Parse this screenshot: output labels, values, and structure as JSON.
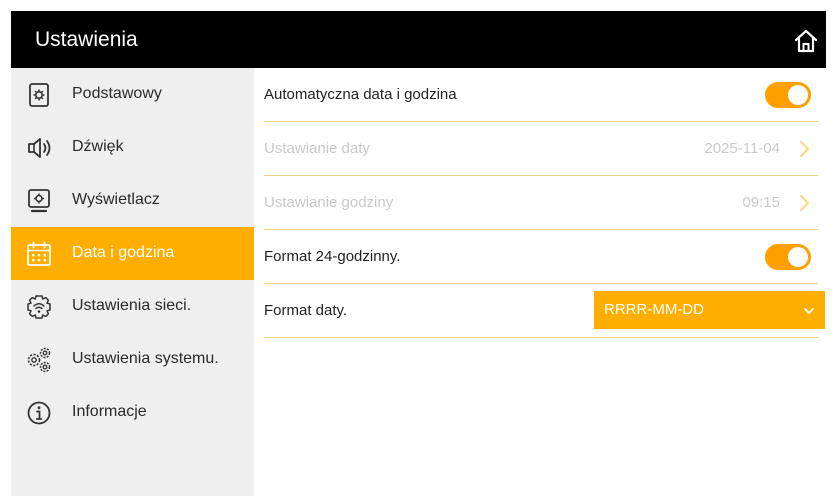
{
  "header": {
    "title": "Ustawienia",
    "home_icon": "home-icon"
  },
  "sidebar": {
    "items": [
      {
        "label": "Podstawowy",
        "icon": "basic-settings-icon",
        "active": false
      },
      {
        "label": "Dźwięk",
        "icon": "speaker-icon",
        "active": false
      },
      {
        "label": "Wyświetlacz",
        "icon": "display-icon",
        "active": false
      },
      {
        "label": "Data i godzina",
        "icon": "calendar-icon",
        "active": true
      },
      {
        "label": "Ustawienia sieci.",
        "icon": "network-settings-icon",
        "active": false
      },
      {
        "label": "Ustawienia systemu.",
        "icon": "system-settings-icon",
        "active": false
      },
      {
        "label": "Informacje",
        "icon": "info-icon",
        "active": false
      }
    ]
  },
  "content": {
    "auto_datetime": {
      "label": "Automatyczna data i godzina",
      "enabled": true
    },
    "date_setting": {
      "label": "Ustawianie daty",
      "value": "2025-11-04",
      "disabled": true
    },
    "time_setting": {
      "label": "Ustawianie godziny",
      "value": "09:15",
      "disabled": true
    },
    "format_24h": {
      "label": "Format 24-godzinny.",
      "enabled": true
    },
    "date_format": {
      "label": "Format daty.",
      "value": "RRRR-MM-DD"
    }
  },
  "colors": {
    "accent": "#ffae00",
    "header_bg": "#000000",
    "sidebar_bg": "#efefef",
    "divider": "#f3d48a",
    "disabled_text": "#c9c9c9"
  }
}
